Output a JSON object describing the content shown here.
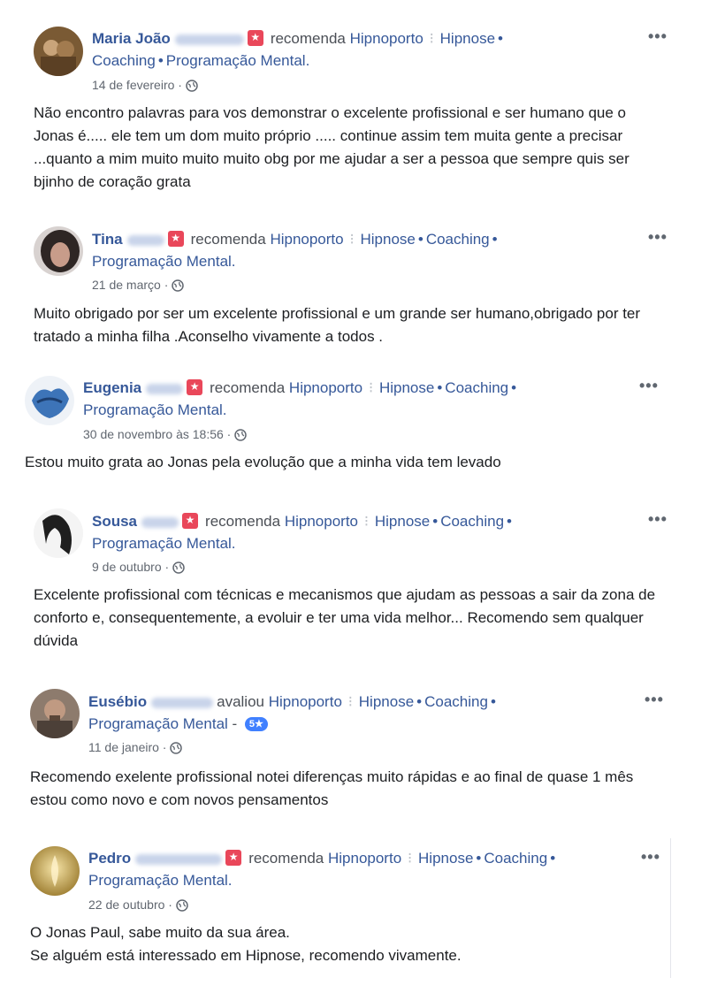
{
  "common": {
    "recommends": "recomenda",
    "reviewed": "avaliou",
    "page_name": "Hipnoporto",
    "separator": "⁝",
    "cat1": "Hipnose",
    "cat2": "Coaching",
    "cat3": "Programação Mental.",
    "cat3_nodot": "Programação Mental",
    "bullet": "•",
    "more": "•••"
  },
  "reviews": [
    {
      "name": "Maria João",
      "date": "14 de fevereiro",
      "privacy_icon": "globe-icon",
      "action": "recomenda",
      "text": "Não encontro palavras para vos demonstrar o excelente profissional e ser humano que o Jonas é..... ele tem um dom muito próprio ..... continue assim tem muita gente a precisar ...quanto a mim muito muito muito obg por me ajudar a ser a pessoa que sempre quis ser bjinho de coração grata"
    },
    {
      "name": "Tina",
      "date": "21 de março",
      "privacy_icon": "globe-icon",
      "action": "recomenda",
      "text": "Muito obrigado por ser um excelente profissional e um grande ser humano,obrigado por ter tratado a minha filha .Aconselho vivamente a todos ."
    },
    {
      "name": "Eugenia",
      "date": "30 de novembro às 18:56",
      "privacy_icon": "globe-icon",
      "action": "recomenda",
      "text": "Estou muito grata ao Jonas pela evolução que a minha vida tem levado"
    },
    {
      "name": "Sousa",
      "date": "9 de outubro",
      "privacy_icon": "globe-icon",
      "action": "recomenda",
      "text": "Excelente profissional com técnicas e mecanismos que ajudam as pessoas a sair da zona de conforto e, consequentemente, a evoluir e ter uma vida melhor... Recomendo sem qualquer dúvida"
    },
    {
      "name": "Eusébio",
      "date": "11 de janeiro",
      "privacy_icon": "globe-icon",
      "action": "avaliou",
      "rating": "5★",
      "text": "Recomendo exelente profissional notei diferenças muito rápidas e ao final de quase 1 mês estou como novo e com novos pensamentos"
    },
    {
      "name": "Pedro",
      "date": "22 de outubro",
      "privacy_icon": "globe-icon",
      "action": "recomenda",
      "text_line1": "O Jonas Paul, sabe muito da sua área.",
      "text_line2": "Se alguém está interessado em Hipnose, recomendo vivamente."
    }
  ],
  "colors": {
    "name_link": "#365899",
    "recommend_icon": "#e9475a",
    "rating_badge": "#4080ff",
    "meta": "#616770"
  }
}
